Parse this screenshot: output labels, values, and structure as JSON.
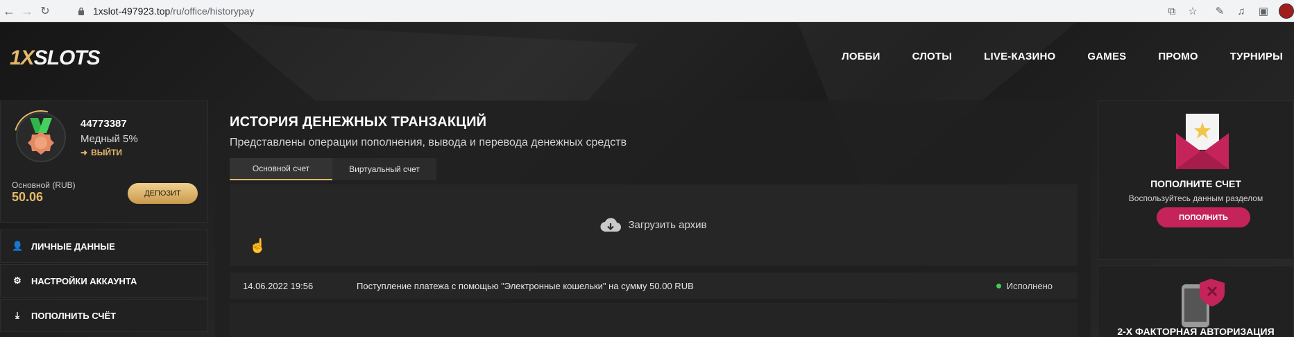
{
  "browser": {
    "url_host": "1xslot-497923.top",
    "url_path": "/ru/office/historypay"
  },
  "brand": {
    "logo_part1": "1X",
    "logo_part2": "SLOTS",
    "accent_gold": "#e4b96b",
    "accent_pink": "#c4245a"
  },
  "topnav": {
    "items": [
      "ЛОББИ",
      "СЛОТЫ",
      "LIVE-КАЗИНО",
      "GAMES",
      "ПРОМО",
      "ТУРНИРЫ"
    ]
  },
  "profile": {
    "user_id": "44773387",
    "rank": "Медный 5%",
    "logout_label": "ВЫЙТИ",
    "account_label": "Основной (RUB)",
    "balance": "50.06",
    "deposit_label": "ДЕПОЗИТ"
  },
  "sidebar": {
    "items": [
      {
        "label": "ЛИЧНЫЕ ДАННЫЕ",
        "icon": "user-plus-icon"
      },
      {
        "label": "НАСТРОЙКИ АККАУНТА",
        "icon": "gears-icon"
      },
      {
        "label": "ПОПОЛНИТЬ СЧЁТ",
        "icon": "download-icon"
      }
    ]
  },
  "main": {
    "title": "ИСТОРИЯ ДЕНЕЖНЫХ ТРАНЗАКЦИЙ",
    "subtitle": "Представлены операции пополнения, вывода и перевода денежных средств",
    "tabs": [
      "Основной счет",
      "Виртуальный счет"
    ],
    "archive_label": "Загрузить архив",
    "transactions": [
      {
        "date": "14.06.2022 19:56",
        "description": "Поступление платежа с помощью \"Электронные кошельки\" на сумму 50.00 RUB",
        "status": "Исполнено"
      }
    ]
  },
  "right": {
    "deposit_card": {
      "title": "ПОПОЛНИТЕ СЧЕТ",
      "subtitle": "Воспользуйтесь данным разделом",
      "button": "ПОПОЛНИТЬ"
    },
    "twofa_card": {
      "title": "2-Х ФАКТОРНАЯ АВТОРИЗАЦИЯ"
    }
  }
}
